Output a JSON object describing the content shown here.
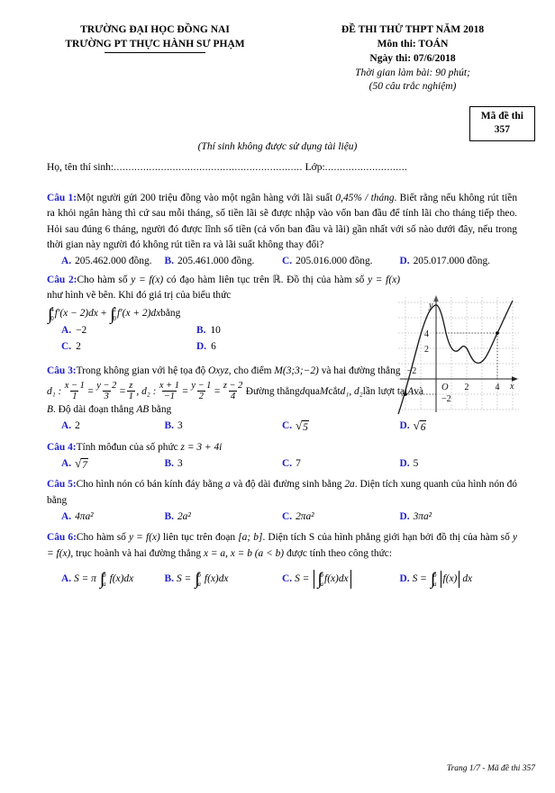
{
  "header": {
    "school_line1": "TRƯỜNG ĐẠI HỌC ĐỒNG NAI",
    "school_line2": "TRƯỜNG PT THỰC HÀNH SƯ PHẠM",
    "exam_title": "ĐỀ THI THỬ THPT NĂM 2018",
    "subject": "Môn thi: TOÁN",
    "date": "Ngày thi: 07/6/2018",
    "duration": "Thời gian làm bài: 90 phút;",
    "question_count": "(50 câu trắc nghiệm)"
  },
  "exam_code": {
    "label": "Mã đề thi",
    "value": "357"
  },
  "notice": "(Thí sinh không được sử dụng tài liệu)",
  "student": {
    "name_label": "Họ, tên thí sinh:",
    "name_dots": "................................................................",
    "class_label": "Lớp:",
    "class_dots": "............................"
  },
  "questions": [
    {
      "label": "Câu 1:",
      "text_a": "Một người gửi ",
      "amount": "200",
      "text_b": " triệu đồng vào một ngân hàng với lãi suất ",
      "rate": "0,45% / tháng",
      "text_c": ". Biết rằng nếu không rút tiền ra khỏi ngân hàng thì cứ sau mỗi tháng, số tiền lãi sẽ được nhập vào vốn ban đầu để tính lãi cho tháng tiếp theo. Hỏi sau đúng 6 tháng, người đó được lĩnh số tiền (cả vốn ban đầu và lãi) gần nhất với số nào dưới đây, nếu trong thời gian này người đó không rút tiền ra và lãi suất không thay đổi?",
      "options": [
        {
          "key": "A.",
          "value": "205.462.000 đồng."
        },
        {
          "key": "B.",
          "value": "205.461.000 đồng."
        },
        {
          "key": "C.",
          "value": "205.016.000 đồng."
        },
        {
          "key": "D.",
          "value": "205.017.000 đồng."
        }
      ]
    },
    {
      "label": "Câu 2:",
      "text_a": "Cho hàm số ",
      "fn1": "y = f(x)",
      "text_b": " có đạo hàm liên tục trên ",
      "set_r": "ℝ",
      "text_c": ". Đồ thị của hàm số ",
      "fn2": "y = f(x)",
      "text_d": " như hình vẽ bên. Khi đó giá trị của biểu thức",
      "expr_int1_upper": "4",
      "expr_int1_lower": "0",
      "expr_int1_body": "f′(x − 2)dx",
      "expr_plus": "+",
      "expr_int2_upper": "2",
      "expr_int2_lower": "0",
      "expr_int2_body": "f′(x + 2)dx",
      "expr_tail": " bằng",
      "options": [
        {
          "key": "A.",
          "value": "−2"
        },
        {
          "key": "B.",
          "value": "10"
        },
        {
          "key": "C.",
          "value": "2"
        },
        {
          "key": "D.",
          "value": "6"
        }
      ]
    },
    {
      "label": "Câu 3:",
      "text_a": "Trong không gian với hệ tọa độ ",
      "coord": "Oxyz",
      "text_b": ", cho điểm ",
      "point": "M(3;3;−2)",
      "text_c": " và hai đường thẳng",
      "d1_name": "d₁ :",
      "d1_f1n": "x − 1",
      "d1_f1d": "1",
      "d1_f2n": "y − 2",
      "d1_f2d": "3",
      "d1_f3n": "z",
      "d1_f3d": "1",
      "d2_name": ", d₂ :",
      "d2_f1n": "x + 1",
      "d2_f1d": "−1",
      "d2_f2n": "y − 1",
      "d2_f2d": "2",
      "d2_f3n": "z − 2",
      "d2_f3d": "4",
      "text_d": " Đường thẳng ",
      "line_d": "d",
      "text_e": " qua ",
      "pt_m": "M",
      "text_f": " cắt ",
      "lines": "d₁, d₂",
      "text_g": " lần lượt tại ",
      "pt_a": "A",
      "text_h": " và ",
      "pt_b": "B",
      "text_i": ". Độ dài đoạn thẳng ",
      "seg": "AB",
      "text_j": " bằng",
      "options": [
        {
          "key": "A.",
          "value": "2"
        },
        {
          "key": "B.",
          "value": "3"
        },
        {
          "key": "C.",
          "value": "√5",
          "sqrt": "5"
        },
        {
          "key": "D.",
          "value": "√6",
          "sqrt": "6"
        }
      ]
    },
    {
      "label": "Câu 4:",
      "text_a": "Tính môđun của số phức ",
      "expr": "z = 3 + 4i",
      "options": [
        {
          "key": "A.",
          "value": "√7",
          "sqrt": "7"
        },
        {
          "key": "B.",
          "value": "3"
        },
        {
          "key": "C.",
          "value": "7"
        },
        {
          "key": "D.",
          "value": "5"
        }
      ]
    },
    {
      "label": "Câu 5:",
      "text_a": "Cho hình nón có bán kính đáy bằng ",
      "r": "a",
      "text_b": " và độ dài đường sinh bằng ",
      "l": "2a",
      "text_c": ". Diện tích xung quanh của hình nón đó bằng",
      "options": [
        {
          "key": "A.",
          "value": "4πa²"
        },
        {
          "key": "B.",
          "value": "2a²"
        },
        {
          "key": "C.",
          "value": "2πa²"
        },
        {
          "key": "D.",
          "value": "3πa²"
        }
      ]
    },
    {
      "label": "Câu 6:",
      "text_a": "Cho hàm số ",
      "fn": "y = f(x)",
      "text_b": " liên tục trên đoạn ",
      "interval": "[a; b]",
      "text_c": ". Diện tích S của hình phẳng giới hạn bởi đồ thị của hàm số ",
      "fn2": "y = f(x)",
      "text_d": ", trục hoành và hai đường thẳng ",
      "lines": "x = a, x = b (a < b)",
      "text_e": " được tính theo công thức:",
      "options": [
        {
          "key": "A.",
          "prefix": "S = π",
          "upper": "b",
          "lower": "a",
          "body": "f(x)dx",
          "style": "pi"
        },
        {
          "key": "B.",
          "prefix": "S =",
          "upper": "b",
          "lower": "a",
          "body": "f(x)dx",
          "style": "plain"
        },
        {
          "key": "C.",
          "prefix": "S =",
          "upper": "b",
          "lower": "a",
          "body": "f(x)dx",
          "style": "abs-outer"
        },
        {
          "key": "D.",
          "prefix": "S =",
          "upper": "b",
          "lower": "a",
          "body": "f(x)",
          "style": "abs-inner",
          "tail": "dx"
        }
      ]
    }
  ],
  "footer": "Trang 1/7 - Mã đề thi 357",
  "chart_data": {
    "type": "line",
    "title": "",
    "xlabel": "x",
    "ylabel": "y",
    "xticks": [
      -2,
      2,
      4
    ],
    "yticks": [
      -2,
      2,
      4
    ],
    "origin_label": "O",
    "xlim": [
      -3.2,
      5.4
    ],
    "ylim": [
      -3.4,
      6.2
    ],
    "grid": true,
    "marked_points": [
      [
        -2,
        -2
      ],
      [
        4,
        4
      ]
    ],
    "curve": "cubic-like curve rising steeply from lower-left through (-2,-2), peaking near x=0 at y≈5, dipping to local min near x=2.4 at y≈1.8, then rising through (4,4)"
  },
  "colors": {
    "accent_blue": "#2020cc",
    "text": "#000000",
    "grid": "#bbbbbb"
  }
}
